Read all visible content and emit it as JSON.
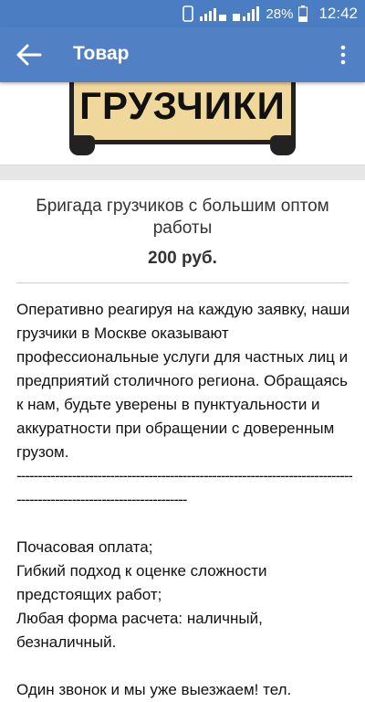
{
  "status_bar": {
    "time": "12:42",
    "battery": "28%"
  },
  "app_bar": {
    "title": "Товар"
  },
  "banner": {
    "sign_text": "ГРУЗЧИКИ"
  },
  "product": {
    "title": "Бригада грузчиков с большим оптом работы",
    "price": "200 руб."
  },
  "description": {
    "paragraph1": "Оперативно реагируя на каждую заявку, наши грузчики в Москве оказывают профессиональные услуги для частных лиц и предприятий столичного региона. Обращаясь к нам, будьте уверены в пунктуальности и аккуратности при обращении с доверенным грузом.",
    "dashes1": "-------------------------------------------------------------------------------",
    "dashes2": "----------------------------------------",
    "line1": "Почасовая оплата;",
    "line2": "Гибкий подход к оценке сложности предстоящих работ;",
    "line3": "Любая форма расчета: наличный, безналичный.",
    "line4": "Один звонок и мы уже выезжаем!  тел."
  }
}
